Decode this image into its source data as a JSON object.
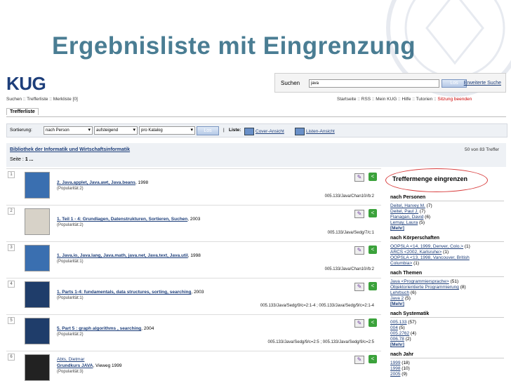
{
  "slide": {
    "title": "Ergebnisliste mit Eingrenzung"
  },
  "app": {
    "logo": "KUG"
  },
  "search": {
    "label": "Suchen",
    "value": "java",
    "button": "Los",
    "advanced": "Erweiterte Suche"
  },
  "nav_left": "Suchen :: Trefferliste :: Merkliste [0]",
  "nav_right": {
    "items": "Startseite :: RSS :: Mein KUG :: Hilfe :: Tutorien :: ",
    "logout": "Sitzung beenden"
  },
  "tab": "Trefferliste",
  "sortbar": {
    "label": "Sortierung:",
    "sort_by": "nach Person",
    "order": "aufsteigend",
    "scope": "pro Katalog",
    "button": "Los",
    "list_label": "Liste:",
    "cover_view": "Cover-Ansicht",
    "list_view": "Listen-Ansicht"
  },
  "results_header": {
    "library": "Bibliothek der Informatik und Wirtschaftsinformatik",
    "count": "50 von 83 Treffer",
    "page_label": "Seite :",
    "page_value": "1 ..."
  },
  "results": [
    {
      "num": "1",
      "title": "2. Java.applet, Java.awt, Java.beans",
      "year": ", 1998",
      "popularity": "(Popularität:2)",
      "signature": "005.133/Java/Chan10//b:2",
      "cover_color": "#3a6fb0"
    },
    {
      "num": "2",
      "title": "1. Teil 1 - 4: Grundlagen, Datenstrukturen, Sortieren, Suchen",
      "year": ", 2003",
      "popularity": "(Popularität:2)",
      "signature": "005.133/Java/Sedg/7/c:1",
      "cover_color": "#d7d2c8"
    },
    {
      "num": "3",
      "title": "1. Java.io, Java.lang, Java.math, java.net, Java.text, Java.util",
      "year": ", 1998",
      "popularity": "(Popularität:1)",
      "signature": "005.133/Java/Chan10//b:2",
      "cover_color": "#3a6fb0"
    },
    {
      "num": "4",
      "title": "1. Parts 1-4: fundamentals, data structures, sorting, searching",
      "year": ", 2003",
      "popularity": "(Popularität:1)",
      "signature": "005.133/Java/Sedg/9/c=2:1-4 ; 005.133/Java/Sedg/9/c=2:1-4",
      "cover_color": "#1f3d6a"
    },
    {
      "num": "5",
      "title": "5. Part 5 : graph algorithms , searching",
      "year": ", 2004",
      "popularity": "(Popularität:2)",
      "signature": "005.133/Java/Sedg/9/c=2:5 ; 005.133/Java/Sedg/9/c=2:5",
      "cover_color": "#1f3d6a"
    },
    {
      "num": "6",
      "author": "Abts, Dietmar",
      "title": "Grundkurs JAVA",
      "year": ", Vieweg 1999",
      "popularity": "(Popularität:3)",
      "signature": "",
      "cover_color": "#222222"
    }
  ],
  "facets": {
    "title": "Treffermenge eingrenzen",
    "sections": [
      {
        "name": "nach Personen",
        "items": [
          {
            "label": "Deitel, Harvey M.",
            "count": "(7)"
          },
          {
            "label": "Deitel, Paul J.",
            "count": "(7)"
          },
          {
            "label": "Flanagan, David",
            "count": "(6)"
          },
          {
            "label": "Lemay, Laura",
            "count": "(5)"
          }
        ],
        "more": "[Mehr]"
      },
      {
        "name": "nach Körperschaften",
        "items": [
          {
            "label": "OOPSLA <14, 1999, Denver, Colo.>",
            "count": "(1)"
          },
          {
            "label": "ARCS <2002, Karlsruhe>",
            "count": "(1)"
          },
          {
            "label": "OOPSLA <13, 1998, Vancouver, British",
            "count": ""
          },
          {
            "label": "Columbia>",
            "count": "(1)"
          }
        ],
        "more": ""
      },
      {
        "name": "nach Themen",
        "items": [
          {
            "label": "Java <Programmiersprache>",
            "count": "(51)"
          },
          {
            "label": "Objektorientierte Programmierung",
            "count": "(8)"
          },
          {
            "label": "Lehrbuch",
            "count": "(6)"
          },
          {
            "label": "Java 2",
            "count": "(5)"
          }
        ],
        "more": "[Mehr]"
      },
      {
        "name": "nach Systematik",
        "items": [
          {
            "label": "005.133",
            "count": "(57)"
          },
          {
            "label": "004",
            "count": "(5)"
          },
          {
            "label": "005.2762",
            "count": "(4)"
          },
          {
            "label": "006.78",
            "count": "(2)"
          }
        ],
        "more": "[Mehr]"
      },
      {
        "name": "nach Jahr",
        "items": [
          {
            "label": "1999",
            "count": "(18)"
          },
          {
            "label": "1998",
            "count": "(10)"
          },
          {
            "label": "2005",
            "count": "(9)"
          }
        ],
        "more": ""
      }
    ]
  }
}
